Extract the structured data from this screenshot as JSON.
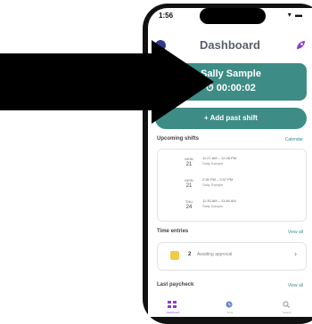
{
  "status_bar": {
    "time": "1:56",
    "icons": "▾ ▬"
  },
  "header": {
    "title": "Dashboard"
  },
  "clock": {
    "name": "Sally Sample",
    "timer": "⏱ 00:00:02"
  },
  "add_past_shift": {
    "label": "+ Add past shift"
  },
  "upcoming_shifts": {
    "title": "Upcoming shifts",
    "link": "Calendar",
    "items": [
      {
        "day": "MON",
        "date": "21",
        "time": "11:27 AM – 12:28 PM",
        "person": "Sally Sample"
      },
      {
        "day": "MON",
        "date": "21",
        "time": "2:36 PM – 3:37 PM",
        "person": "Sally Sample"
      },
      {
        "day": "THU",
        "date": "24",
        "time": "11:30 AM – 11:46 AM",
        "person": "Sally Sample"
      }
    ]
  },
  "time_entries": {
    "title": "Time entries",
    "link": "View all",
    "count": "2",
    "status": "Awaiting approval",
    "chevron": "›"
  },
  "last_paycheck": {
    "title": "Last paycheck",
    "link": "View all"
  },
  "tabs": [
    {
      "label": "Dashboard",
      "icon": "grid-icon",
      "color": "#8e3bd0"
    },
    {
      "label": "Time",
      "icon": "clock-icon",
      "color": "#6b86c9"
    },
    {
      "label": "Search",
      "icon": "search-icon",
      "color": "#888888"
    }
  ],
  "colors": {
    "accent": "#3e8c86",
    "purple": "#8e3bd0"
  }
}
